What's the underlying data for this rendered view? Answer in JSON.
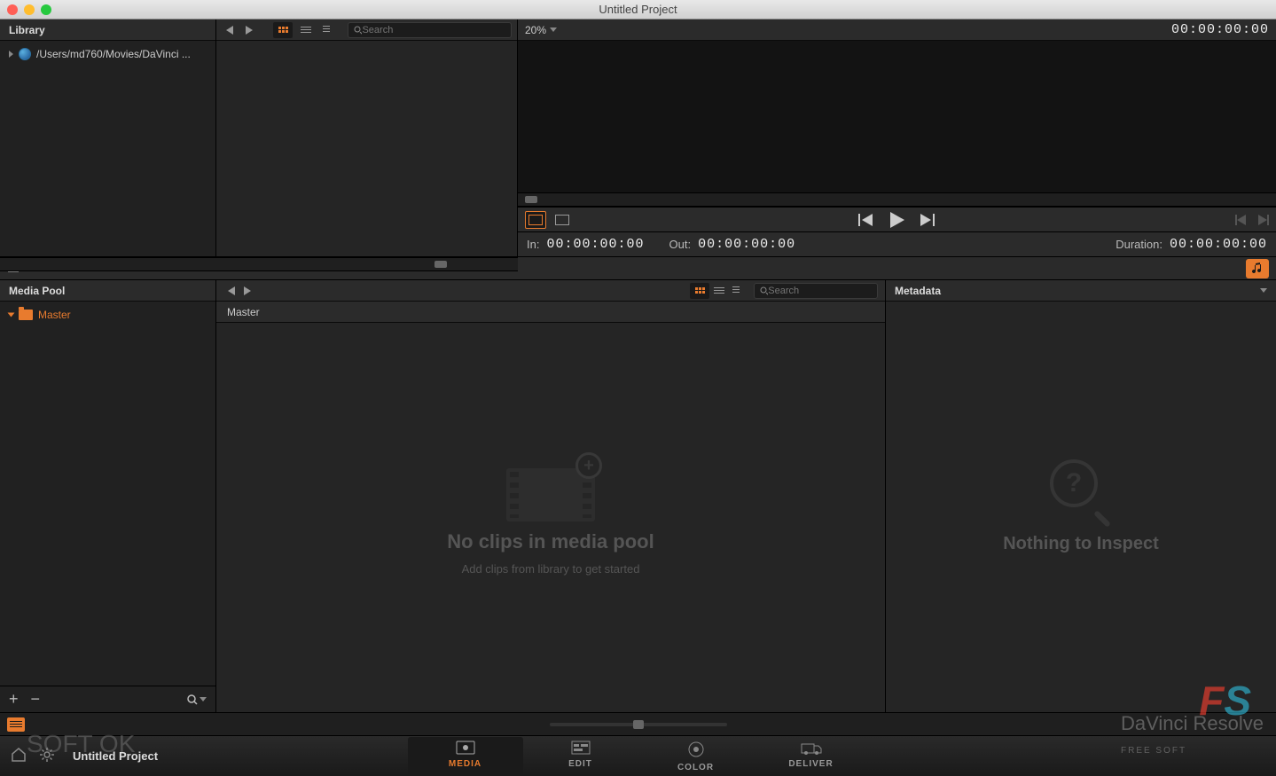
{
  "window": {
    "title": "Untitled Project"
  },
  "library": {
    "title": "Library",
    "path": "/Users/md760/Movies/DaVinci ..."
  },
  "browser": {
    "search_placeholder": "Search"
  },
  "viewer": {
    "zoom": "20%",
    "timecode": "00:00:00:00",
    "in_label": "In:",
    "in_tc": "00:00:00:00",
    "out_label": "Out:",
    "out_tc": "00:00:00:00",
    "duration_label": "Duration:",
    "duration_tc": "00:00:00:00"
  },
  "media_pool": {
    "title": "Media Pool",
    "master": "Master",
    "header": "Master",
    "search_placeholder": "Search",
    "empty_title": "No clips in media pool",
    "empty_sub": "Add clips from library to get started"
  },
  "metadata": {
    "title": "Metadata",
    "empty": "Nothing to Inspect"
  },
  "footer": {
    "project": "Untitled Project",
    "tabs": {
      "media": "MEDIA",
      "edit": "EDIT",
      "color": "COLOR",
      "deliver": "DELIVER"
    }
  },
  "watermarks": {
    "left": "SOFT OK",
    "right": "DaVinci Resolve",
    "right_sub": "FREE SOFT"
  }
}
